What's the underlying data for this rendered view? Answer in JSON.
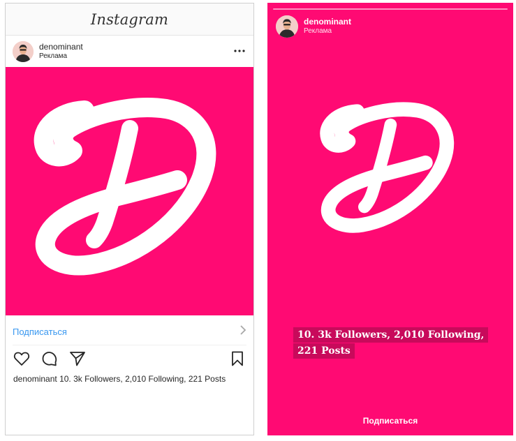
{
  "colors": {
    "brand_pink": "#ff0a73",
    "sticker_bg": "#c80a5b",
    "link_blue": "#3897f0",
    "header_bg": "#fafafa"
  },
  "feed": {
    "app_title": "Instagram",
    "account": {
      "name": "denominant",
      "sponsored_label": "Реклама"
    },
    "more_icon": "more-dots-icon",
    "cta": {
      "label": "Подписаться",
      "icon": "chevron-right-icon"
    },
    "actions": [
      "heart-icon",
      "comment-icon",
      "share-icon",
      "bookmark-icon"
    ],
    "caption": {
      "username": "denominant",
      "text": "10. 3k Followers, 2,010 Following, 221 Posts"
    }
  },
  "story": {
    "account": {
      "name": "denominant",
      "sponsored_label": "Реклама"
    },
    "sticker_lines": [
      "10. 3k Followers, 2,010 Following,",
      "221 Posts"
    ],
    "cta_label": "Подписаться"
  }
}
